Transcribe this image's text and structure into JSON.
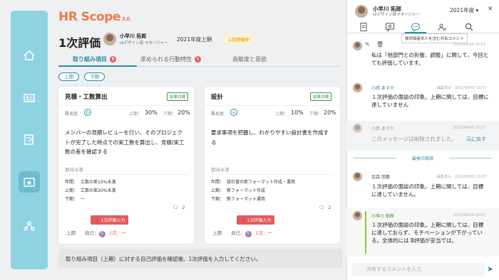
{
  "app": {
    "logo": "HR Scope",
    "version": "3.0"
  },
  "nav": {
    "items": [
      "home-icon",
      "profile-card-icon",
      "edit-document-icon",
      "evaluation-icon",
      "org-chart-icon"
    ],
    "active_index": 3
  },
  "header": {
    "title": "1次評価",
    "user_name": "小早川 拓郎",
    "user_role": "UIデザイン部 マネージャー",
    "period": "2021年度上期",
    "status": "1次評価中"
  },
  "tabs": [
    {
      "label": "取り組み項目",
      "count": "5"
    },
    {
      "label": "求められる行動特性",
      "count": "5"
    },
    {
      "label": "貢献度と意欲",
      "count": ""
    }
  ],
  "filters": {
    "upper": "上期",
    "lower": "下期"
  },
  "cards": [
    {
      "title": "見積・工数算出",
      "tag": "結果目標",
      "difficulty_label": "難易度",
      "difficulty": "b",
      "upper_label": "上期：",
      "upper_value": "30%",
      "lower_label": "下期：",
      "lower_value": "20%",
      "description": "メンバーの見積レビューを行い、そのプロジェクトが完了した時点での実工数を算出し、見積/実工数の差を確認する",
      "target_label": "期待水準",
      "levels": [
        {
          "label": "年間：",
          "value": "工数の差15%未満"
        },
        {
          "label": "上期：",
          "value": "工数の差20%未満"
        },
        {
          "label": "下期：",
          "value": "ー"
        }
      ],
      "comments": "2",
      "error": "1次評価入力",
      "footer_period": "上期",
      "self_label": "自己：",
      "self_score": "S",
      "first_label": "1次：",
      "first_score": "ー"
    },
    {
      "title": "設計",
      "tag": "結果目標",
      "difficulty_label": "難易度",
      "difficulty": "a",
      "upper_label": "上期：",
      "upper_value": "10%",
      "lower_label": "下期：",
      "lower_value": "20%",
      "description": "要求事項を把握し、わかりやすい設計書を作成する",
      "target_label": "期待水準",
      "levels": [
        {
          "label": "年間：",
          "value": "設計書の新フォーマット作成・運用"
        },
        {
          "label": "上期：",
          "value": "新フォーマット作成"
        },
        {
          "label": "下期：",
          "value": "新フォーマット運用"
        }
      ],
      "comments": "2",
      "error": "1次評価入力",
      "footer_period": "上期",
      "self_label": "自己：",
      "self_score": "S",
      "first_label": "1次：",
      "first_score": "ー"
    }
  ],
  "status_bar": "取り組み項目（上期）に対する自己評価を確認後、1次評価を入力してください。",
  "panel": {
    "user_name": "小早川 拓郎",
    "user_role": "UIデザイン部マネージャー",
    "year": "2021年度",
    "tooltip": "被評価者本人を含む共有コメント",
    "messages": [
      {
        "name": "",
        "meta": "2021/06/03 10:57",
        "text": "私は「他部門との折衝、調整」に関して、今回とても評価しています。",
        "variant": "editing"
      },
      {
        "name": "小西 あすか",
        "meta": "編集済み　2021/06/03 10:57",
        "text": "１次評価の面談の印象。上期に関しては、目標に達していません",
        "variant": "normal"
      },
      {
        "name": "小西 あすか",
        "meta": "2021/06/03 10:57",
        "text": "このメッセージは削除されました。",
        "undo": "元に戻す",
        "variant": "deleted"
      }
    ],
    "history_label": "最後の既読",
    "history": [
      {
        "name": "金森 朋義",
        "meta": "編集済み　2021/06/03 10:57",
        "text": "１次評価の面談の印象。上期に関しては、目標に達していません。",
        "variant": "normal"
      },
      {
        "name": "小早川 拓郎",
        "meta": "2021/06/03 10:57",
        "text": "１次評価の面談の印象。上期に関しては、目標に達しておらず、モチベーションが下がっている。全体的には B評価が妥当では。",
        "variant": "mine"
      }
    ],
    "composer_placeholder": "共有するコメントを入力"
  },
  "colors": {
    "accent": "#2d8aa6",
    "nav": "#8fd3e3",
    "brand": "#f07a4a",
    "error": "#e55a5a",
    "self_score": "#9a7fb8"
  }
}
